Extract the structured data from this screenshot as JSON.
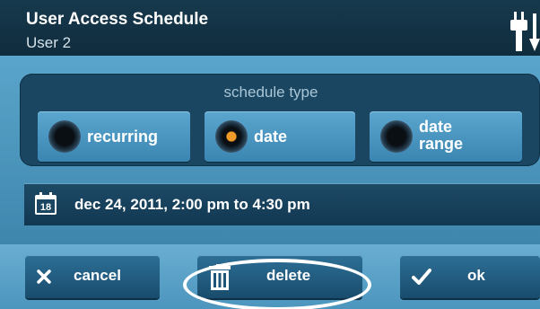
{
  "header": {
    "title": "User Access Schedule",
    "subtitle": "User 2"
  },
  "schedule": {
    "group_label": "schedule type",
    "options": [
      {
        "label": "recurring",
        "selected": false
      },
      {
        "label": "date",
        "selected": true
      },
      {
        "label_line1": "date",
        "label_line2": "range",
        "selected": false
      }
    ],
    "calendar_day": "18",
    "date_value": "dec 24, 2011, 2:00 pm to 4:30 pm"
  },
  "footer": {
    "cancel_label": "cancel",
    "delete_label": "delete",
    "ok_label": "ok"
  },
  "colors": {
    "accent": "#f09a2a",
    "header_bg": "#17394d",
    "panel_bg": "#4f97bd"
  },
  "icons": [
    "power-plug-icon",
    "calendar-icon",
    "close-icon",
    "trash-icon",
    "check-icon"
  ]
}
